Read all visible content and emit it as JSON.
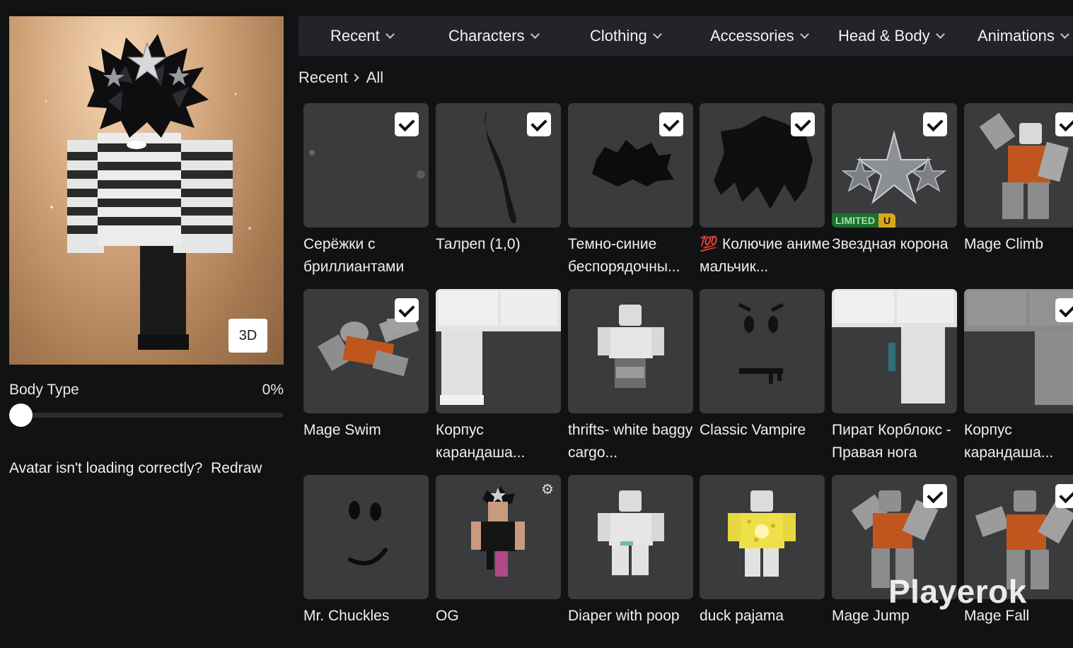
{
  "preview": {
    "btn_3d": "3D"
  },
  "body_type": {
    "label": "Body Type",
    "value": "0%"
  },
  "help": {
    "text": "Avatar isn't loading correctly?",
    "link": "Redraw"
  },
  "nav": {
    "tabs": [
      {
        "label": "Recent"
      },
      {
        "label": "Characters"
      },
      {
        "label": "Clothing"
      },
      {
        "label": "Accessories"
      },
      {
        "label": "Head & Body"
      },
      {
        "label": "Animations"
      }
    ]
  },
  "breadcrumb": {
    "root": "Recent",
    "current": "All"
  },
  "items": [
    {
      "name": "Серёжки с бриллиантами",
      "checked": true,
      "icon": "earrings-icon"
    },
    {
      "name": "Талреп (1,0)",
      "checked": true,
      "icon": "lanyard-icon"
    },
    {
      "name": "Темно-синие беспорядочны...",
      "checked": true,
      "icon": "dark-hair-icon"
    },
    {
      "name": "💯 Колючие аниме мальчик...",
      "checked": true,
      "icon": "spiky-hair-icon"
    },
    {
      "name": "Звездная корона",
      "checked": true,
      "icon": "star-crown-icon",
      "badge": "LIMITED",
      "badge_u": "U"
    },
    {
      "name": "Mage Climb",
      "checked": true,
      "icon": "climb-animation-icon"
    },
    {
      "name": "Mage Swim",
      "checked": true,
      "icon": "swim-animation-icon"
    },
    {
      "name": "Корпус карандаша...",
      "checked": false,
      "icon": "pencil-torso-icon"
    },
    {
      "name": "thrifts- white baggy cargo...",
      "checked": false,
      "icon": "cargo-pants-icon"
    },
    {
      "name": "Classic Vampire",
      "checked": false,
      "icon": "vampire-face-icon"
    },
    {
      "name": "Пират Корблокс - Правая нога",
      "checked": false,
      "icon": "pirate-leg-icon"
    },
    {
      "name": "Корпус карандаша...",
      "checked": true,
      "icon": "pencil-torso-icon"
    },
    {
      "name": "Mr. Chuckles",
      "checked": false,
      "icon": "smile-face-icon"
    },
    {
      "name": "OG",
      "checked": false,
      "icon": "outfit-icon",
      "gear": "⚙"
    },
    {
      "name": "Diaper with poop",
      "checked": false,
      "icon": "diaper-icon"
    },
    {
      "name": "duck pajama",
      "checked": false,
      "icon": "pajama-icon"
    },
    {
      "name": "Mage Jump",
      "checked": true,
      "icon": "jump-animation-icon"
    },
    {
      "name": "Mage Fall",
      "checked": true,
      "icon": "fall-animation-icon"
    }
  ],
  "watermark": "Playerok"
}
